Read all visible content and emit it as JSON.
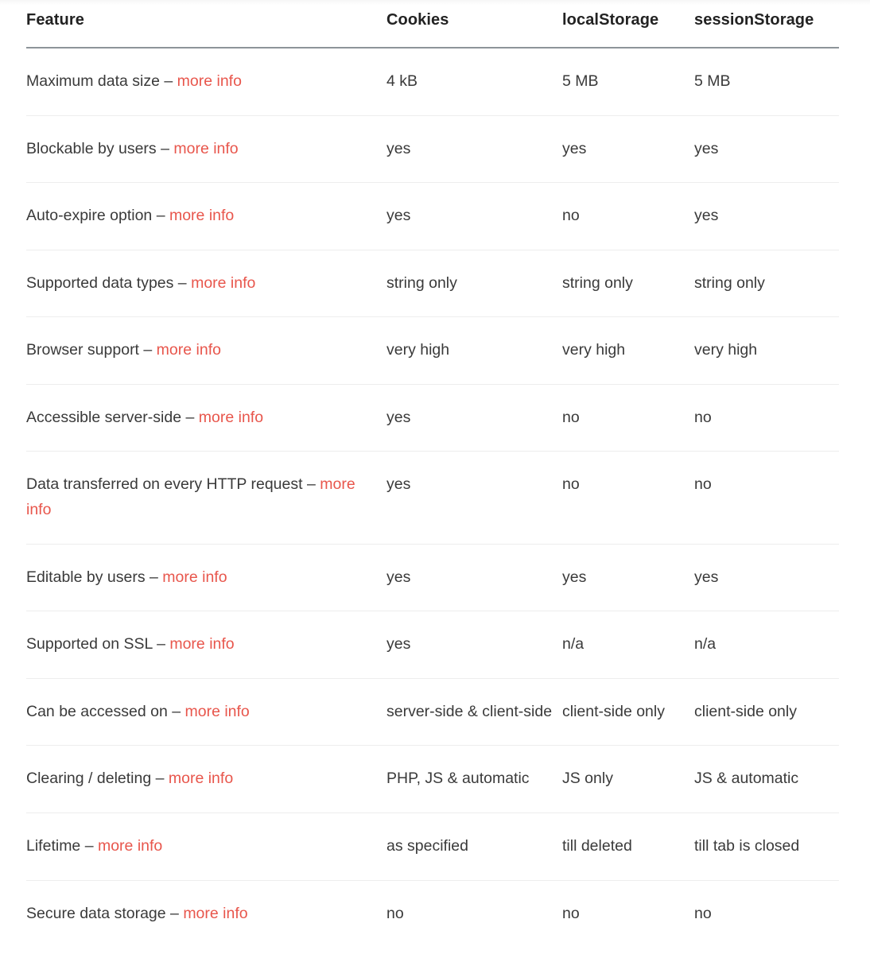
{
  "table": {
    "headers": [
      "Feature",
      "Cookies",
      "localStorage",
      "sessionStorage"
    ],
    "link_label": "more info",
    "separator": "–",
    "link_color": "#e8564c",
    "text_color": "#3a3a3a",
    "header_color": "#222222",
    "rows": [
      {
        "feature": "Maximum data size",
        "link": "more info",
        "cookies": "4 kB",
        "localstorage": "5 MB",
        "sessionstorage": "5 MB"
      },
      {
        "feature": "Blockable by users",
        "link": "more info",
        "cookies": "yes",
        "localstorage": "yes",
        "sessionstorage": "yes"
      },
      {
        "feature": "Auto-expire option",
        "link": "more info",
        "cookies": "yes",
        "localstorage": "no",
        "sessionstorage": "yes"
      },
      {
        "feature": "Supported data types",
        "link": "more info",
        "cookies": "string only",
        "localstorage": "string only",
        "sessionstorage": "string only"
      },
      {
        "feature": "Browser support",
        "link": "more info",
        "cookies": "very high",
        "localstorage": "very high",
        "sessionstorage": "very high"
      },
      {
        "feature": "Accessible server-side",
        "link": "more info",
        "cookies": "yes",
        "localstorage": "no",
        "sessionstorage": "no"
      },
      {
        "feature": "Data transferred on every HTTP request",
        "link": "more info",
        "cookies": "yes",
        "localstorage": "no",
        "sessionstorage": "no"
      },
      {
        "feature": "Editable by users",
        "link": "more info",
        "cookies": "yes",
        "localstorage": "yes",
        "sessionstorage": "yes"
      },
      {
        "feature": "Supported on SSL",
        "link": "more info",
        "cookies": "yes",
        "localstorage": "n/a",
        "sessionstorage": "n/a"
      },
      {
        "feature": "Can be accessed on",
        "link": "more info",
        "cookies": "server-side & client-side",
        "localstorage": "client-side only",
        "sessionstorage": "client-side only"
      },
      {
        "feature": "Clearing / deleting",
        "link": "more info",
        "cookies": "PHP, JS & automatic",
        "localstorage": "JS only",
        "sessionstorage": "JS & automatic"
      },
      {
        "feature": "Lifetime",
        "link": "more info",
        "cookies": "as specified",
        "localstorage": "till deleted",
        "sessionstorage": "till tab is closed"
      },
      {
        "feature": "Secure data storage",
        "link": "more info",
        "cookies": "no",
        "localstorage": "no",
        "sessionstorage": "no"
      }
    ]
  }
}
